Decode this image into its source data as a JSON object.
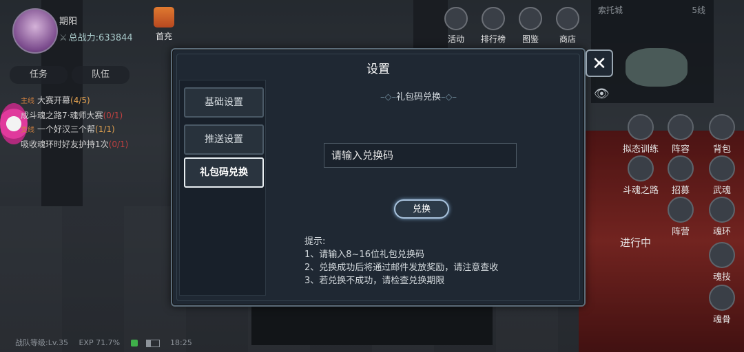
{
  "player": {
    "name": "期阳",
    "power_label": "总战力:",
    "power_value": "633844"
  },
  "gift": {
    "label": "首充"
  },
  "top_menu": [
    {
      "label": "活动",
      "icon": "activity-icon"
    },
    {
      "label": "排行榜",
      "icon": "trophy-icon"
    },
    {
      "label": "图鉴",
      "icon": "atlas-icon"
    },
    {
      "label": "商店",
      "icon": "shop-icon"
    }
  ],
  "minimap": {
    "city": "索托城",
    "line": "5线"
  },
  "tabs": [
    {
      "label": "任务"
    },
    {
      "label": "队伍"
    }
  ],
  "quests": [
    {
      "tag": "主线",
      "title": "大赛开幕",
      "count": "(4/5)",
      "desc": "成斗魂之路7·魂师大赛",
      "progress": "(0/1)"
    },
    {
      "tag": "支线",
      "title": "一个好汉三个帮",
      "count": "(1/1)",
      "desc": "吸收魂环时好友护持1次",
      "progress": "(0/1)"
    }
  ],
  "side_menu": [
    {
      "label": "拟态训练",
      "icon": "training-icon"
    },
    {
      "label": "阵容",
      "icon": "lineup-icon"
    },
    {
      "label": "背包",
      "icon": "bag-icon"
    },
    {
      "label": "斗魂之路",
      "icon": "soul-road-icon"
    },
    {
      "label": "招募",
      "icon": "recruit-icon"
    },
    {
      "label": "武魂",
      "icon": "martial-soul-icon"
    },
    {
      "label": "魂环",
      "icon": "soul-ring-icon"
    },
    {
      "label": "阵营",
      "icon": "camp-icon"
    },
    {
      "label": "魂技",
      "icon": "soul-skill-icon"
    },
    {
      "label": "魂骨",
      "icon": "soul-bone-icon"
    }
  ],
  "in_progress": "进行中",
  "status_bar": {
    "level": "战队等级:Lv.35",
    "exp": "EXP 71.7%",
    "time": "18:25"
  },
  "dialog": {
    "title": "设置",
    "menu": [
      {
        "label": "基础设置",
        "active": false
      },
      {
        "label": "推送设置",
        "active": false
      },
      {
        "label": "礼包码兑换",
        "active": true
      }
    ],
    "section_title": "礼包码兑换",
    "input_placeholder": "请输入兑换码",
    "redeem_label": "兑换",
    "tips_title": "提示:",
    "tips": [
      "1、请输入8~16位礼包兑换码",
      "2、兑换成功后将通过邮件发放奖励，请注意查收",
      "3、若兑换不成功，请检查兑换期限"
    ],
    "close_symbol": "✕"
  }
}
